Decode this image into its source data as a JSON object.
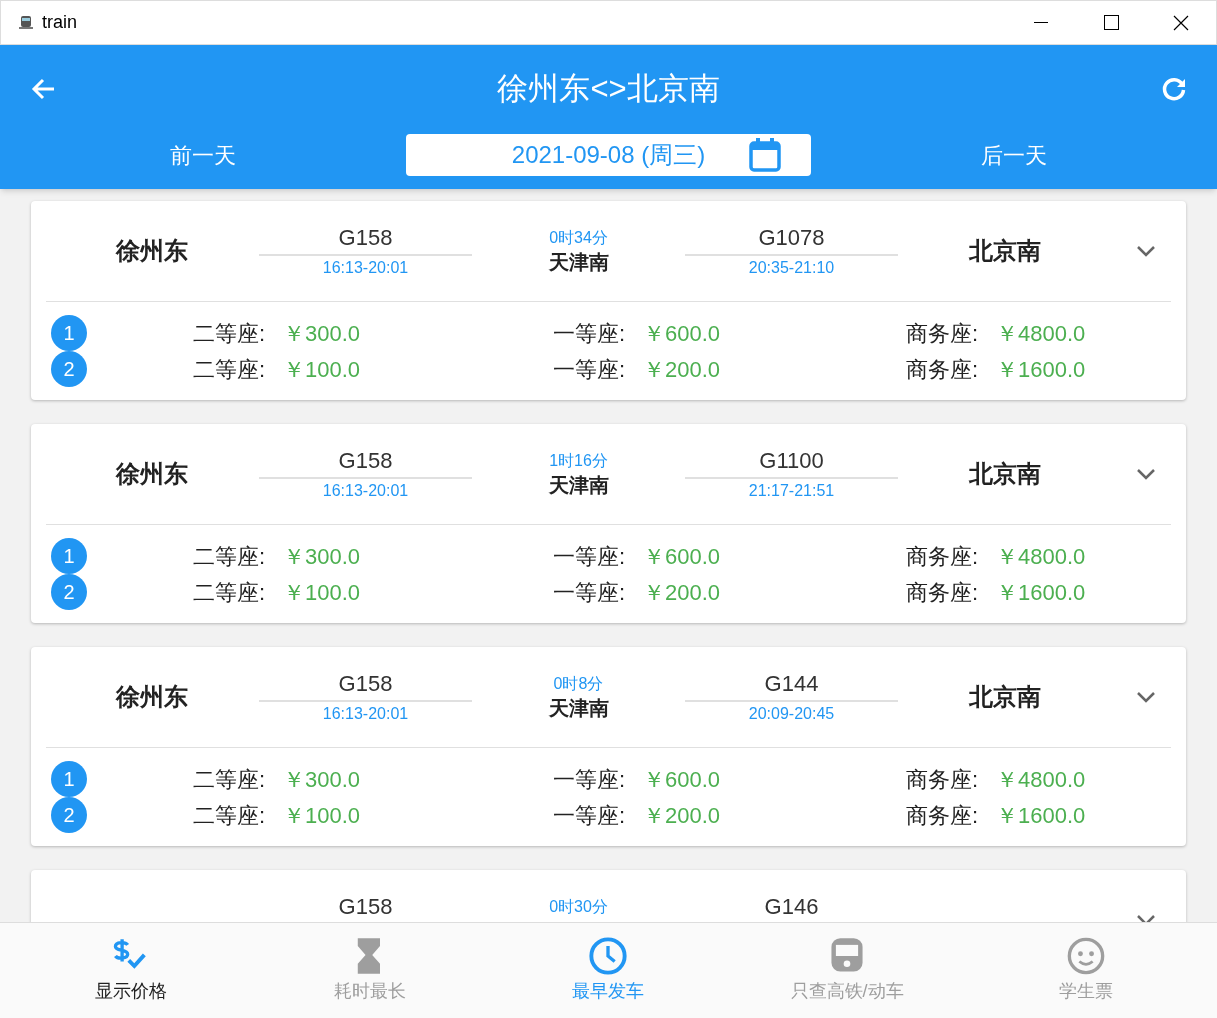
{
  "window": {
    "title": "train"
  },
  "header": {
    "title": "徐州东<>北京南",
    "prev_day": "前一天",
    "date": "2021-09-08 (周三)",
    "next_day": "后一天"
  },
  "routes": [
    {
      "from": "徐州东",
      "leg1": {
        "train": "G158",
        "times": "16:13-20:01"
      },
      "transfer_wait": "0时34分",
      "via": "天津南",
      "leg2": {
        "train": "G1078",
        "times": "20:35-21:10"
      },
      "to": "北京南",
      "expanded": false,
      "fares": [
        {
          "index": "1",
          "seats": [
            {
              "label": "二等座:",
              "price": "￥300.0"
            },
            {
              "label": "一等座:",
              "price": "￥600.0"
            },
            {
              "label": "商务座:",
              "price": "￥4800.0"
            }
          ]
        },
        {
          "index": "2",
          "seats": [
            {
              "label": "二等座:",
              "price": "￥100.0"
            },
            {
              "label": "一等座:",
              "price": "￥200.0"
            },
            {
              "label": "商务座:",
              "price": "￥1600.0"
            }
          ]
        }
      ]
    },
    {
      "from": "徐州东",
      "leg1": {
        "train": "G158",
        "times": "16:13-20:01"
      },
      "transfer_wait": "1时16分",
      "via": "天津南",
      "leg2": {
        "train": "G1100",
        "times": "21:17-21:51"
      },
      "to": "北京南",
      "expanded": false,
      "fares": [
        {
          "index": "1",
          "seats": [
            {
              "label": "二等座:",
              "price": "￥300.0"
            },
            {
              "label": "一等座:",
              "price": "￥600.0"
            },
            {
              "label": "商务座:",
              "price": "￥4800.0"
            }
          ]
        },
        {
          "index": "2",
          "seats": [
            {
              "label": "二等座:",
              "price": "￥100.0"
            },
            {
              "label": "一等座:",
              "price": "￥200.0"
            },
            {
              "label": "商务座:",
              "price": "￥1600.0"
            }
          ]
        }
      ]
    },
    {
      "from": "徐州东",
      "leg1": {
        "train": "G158",
        "times": "16:13-20:01"
      },
      "transfer_wait": "0时8分",
      "via": "天津南",
      "leg2": {
        "train": "G144",
        "times": "20:09-20:45"
      },
      "to": "北京南",
      "expanded": false,
      "fares": [
        {
          "index": "1",
          "seats": [
            {
              "label": "二等座:",
              "price": "￥300.0"
            },
            {
              "label": "一等座:",
              "price": "￥600.0"
            },
            {
              "label": "商务座:",
              "price": "￥4800.0"
            }
          ]
        },
        {
          "index": "2",
          "seats": [
            {
              "label": "二等座:",
              "price": "￥100.0"
            },
            {
              "label": "一等座:",
              "price": "￥200.0"
            },
            {
              "label": "商务座:",
              "price": "￥1600.0"
            }
          ]
        }
      ]
    },
    {
      "leg1": {
        "train": "G158"
      },
      "transfer_wait": "0时30分",
      "leg2": {
        "train": "G146"
      },
      "expanded": false
    }
  ],
  "bottom_nav": [
    {
      "kind": "toggle",
      "label": "显示价格",
      "on": true
    },
    {
      "kind": "sort",
      "label": "耗时最长",
      "selected": false
    },
    {
      "kind": "sort",
      "label": "最早发车",
      "selected": true
    },
    {
      "kind": "toggle",
      "label": "只查高铁/动车",
      "on": false
    },
    {
      "kind": "toggle",
      "label": "学生票",
      "on": false
    }
  ]
}
